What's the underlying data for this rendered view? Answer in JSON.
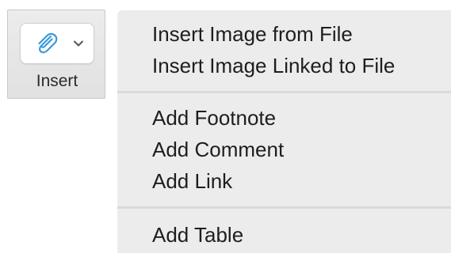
{
  "toolbar": {
    "insert_button": {
      "label": "Insert",
      "icon": "paperclip-icon",
      "dropdown_icon": "chevron-down-icon",
      "accent_color": "#3a9ad9"
    }
  },
  "menu": {
    "items": [
      {
        "label": "Insert Image from File"
      },
      {
        "label": "Insert Image Linked to File"
      },
      {
        "label": "Add Footnote"
      },
      {
        "label": "Add Comment"
      },
      {
        "label": "Add Link"
      },
      {
        "label": "Add Table"
      }
    ]
  }
}
